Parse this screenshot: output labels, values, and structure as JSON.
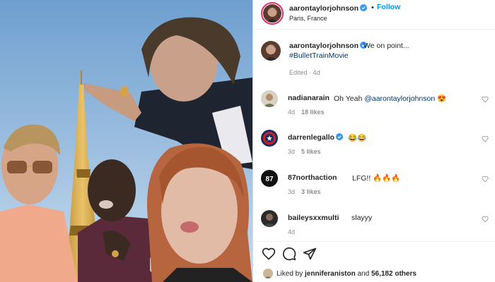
{
  "post": {
    "author": "aarontaylorjohnson",
    "follow_label": "Follow",
    "dot": "•",
    "location": "Paris, France",
    "caption_text": "We on point...",
    "caption_hashtag": "#BulletTrainMovie",
    "caption_meta": "Edited · 4d"
  },
  "comments": [
    {
      "user": "nadianarain",
      "text": "Oh Yeah ",
      "mention": "@aarontaylorjohnson",
      "emoji": "😍",
      "time": "4d",
      "likes": "18 likes"
    },
    {
      "user": "darrenlegallo",
      "text": "😂😂",
      "time": "3d",
      "likes": "5 likes"
    },
    {
      "user": "87northaction",
      "text": "LFG!! 🔥🔥🔥",
      "time": "3d",
      "likes": "3 likes"
    },
    {
      "user": "baileysxxmulti",
      "text": "slayyy",
      "time": "4d",
      "likes": ""
    }
  ],
  "liked_by": {
    "prefix": "Liked by ",
    "user": "jenniferaniston",
    "middle": " and ",
    "count": "56,182 others"
  },
  "icons": {
    "verified": "verified-badge-icon",
    "like": "heart-icon",
    "comment": "comment-bubble-icon",
    "share": "paper-plane-icon"
  },
  "colors": {
    "follow_blue": "#0095f6",
    "link_blue": "#00376b",
    "verified_blue": "#3897f0",
    "muted_gray": "#8e8e8e"
  }
}
